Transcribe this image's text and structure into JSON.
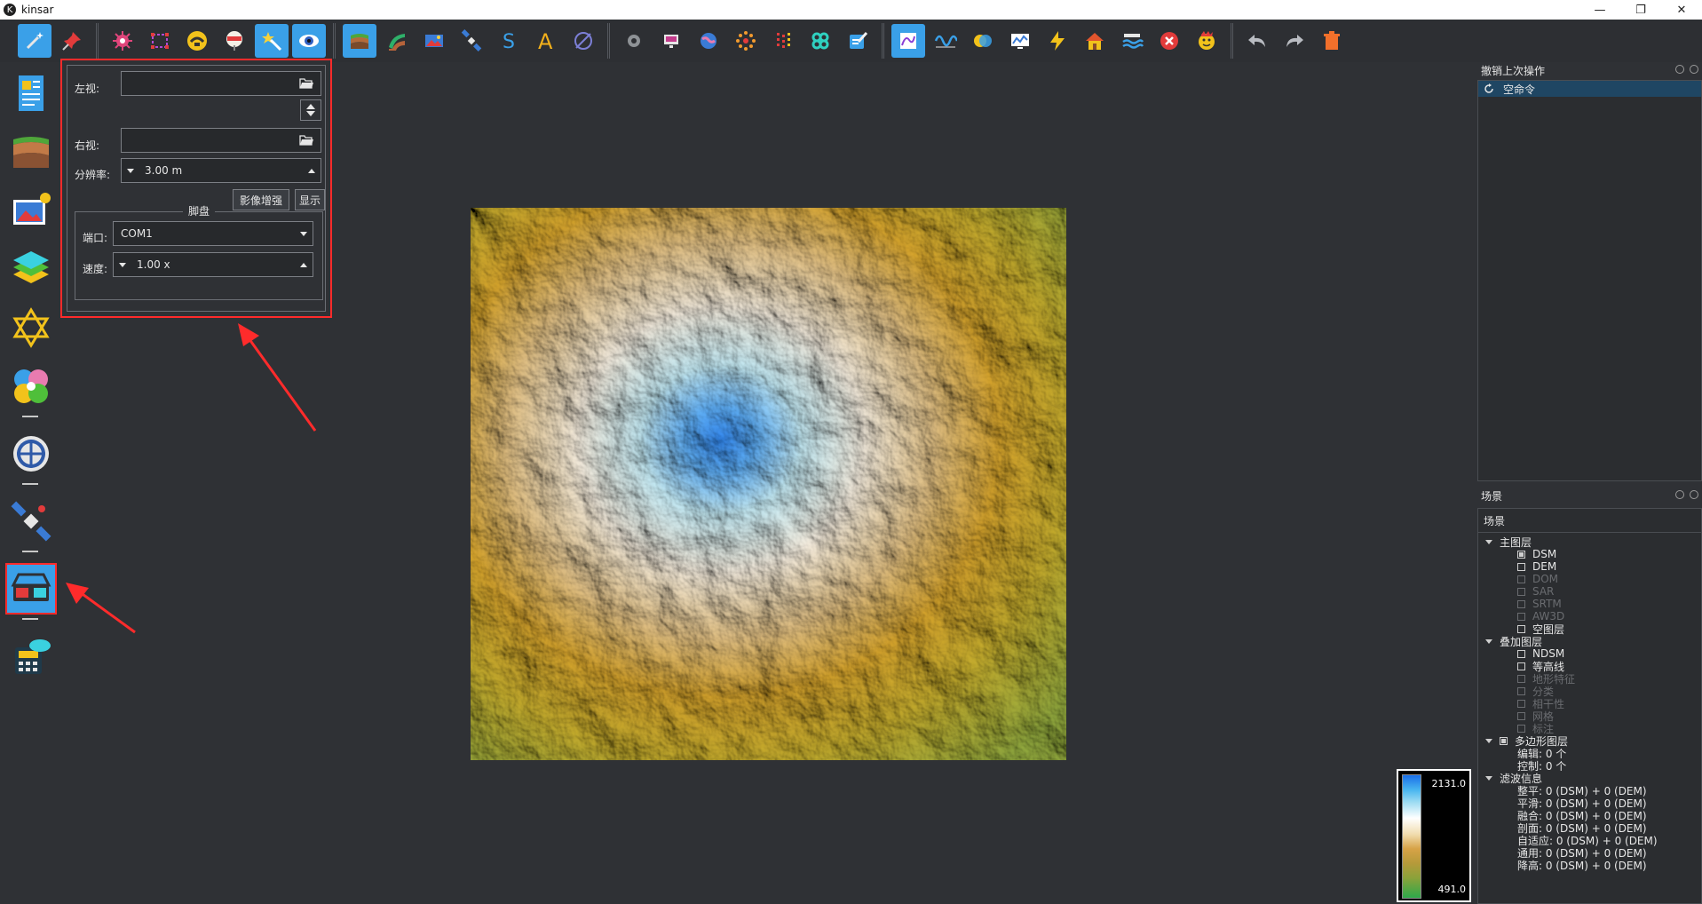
{
  "window": {
    "title": "kinsar",
    "logo": "K",
    "minimize": "—",
    "maximize": "❐",
    "close": "✕"
  },
  "toolbar": {
    "groups": [
      [
        "magic-wand-icon",
        "pin-icon"
      ],
      [
        "virus-icon",
        "vector-select-icon",
        "caution-sign-icon",
        "road-sign-icon",
        "star-wand-icon",
        "eye-icon"
      ],
      [
        "terrain-layers-icon",
        "layers-curve-icon",
        "image-edit-icon",
        "satellite-icon",
        "text-s-icon",
        "text-a-icon",
        "null-icon"
      ],
      [
        "cloud-gear-icon",
        "monitor-icon",
        "globe-icon",
        "sparkle-icon",
        "dots-grid-icon",
        "flower-icon",
        "pen-paper-icon"
      ],
      [
        "chart-frame-icon",
        "wave-icon",
        "overlap-circles-icon",
        "screen-graph-icon",
        "lightning-icon",
        "house-icon",
        "water-icon",
        "close-circle-icon",
        "face-icon"
      ],
      [
        "undo-icon",
        "redo-icon",
        "trash-icon"
      ]
    ]
  },
  "left_panel": {
    "left_view_label": "左视:",
    "left_view_value": "",
    "right_view_label": "右视:",
    "right_view_value": "",
    "resolution_label": "分辨率:",
    "resolution_value": "3.00 m",
    "enhance_button": "影像增强",
    "show_button": "显示",
    "pedal_group": "脚盘",
    "port_label": "端口:",
    "port_value": "COM1",
    "speed_label": "速度:",
    "speed_value": "1.00 x"
  },
  "colorbar": {
    "max": "2131.0",
    "min": "491.0"
  },
  "undo_panel": {
    "title": "撤销上次操作",
    "items": [
      "空命令"
    ]
  },
  "scene_panel": {
    "title": "场景",
    "header": "场景",
    "main_layer": "主图层",
    "main_items": [
      {
        "label": "DSM",
        "checked": true,
        "dim": false
      },
      {
        "label": "DEM",
        "checked": false,
        "dim": false
      },
      {
        "label": "DOM",
        "checked": false,
        "dim": true
      },
      {
        "label": "SAR",
        "checked": false,
        "dim": true
      },
      {
        "label": "SRTM",
        "checked": false,
        "dim": true
      },
      {
        "label": "AW3D",
        "checked": false,
        "dim": true
      },
      {
        "label": "空图层",
        "checked": false,
        "dim": false
      }
    ],
    "overlay_layer": "叠加图层",
    "overlay_items": [
      {
        "label": "NDSM",
        "checked": false,
        "dim": false
      },
      {
        "label": "等高线",
        "checked": false,
        "dim": false
      },
      {
        "label": "地形特征",
        "checked": false,
        "dim": true
      },
      {
        "label": "分类",
        "checked": false,
        "dim": true
      },
      {
        "label": "相干性",
        "checked": false,
        "dim": true
      },
      {
        "label": "网格",
        "checked": false,
        "dim": true
      },
      {
        "label": "标注",
        "checked": false,
        "dim": true
      }
    ],
    "polygon_layer": "多边形图层",
    "polygon_items": [
      "编辑: 0 个",
      "控制: 0 个"
    ],
    "filter_info": "滤波信息",
    "filter_items": [
      "整平: 0 (DSM) + 0 (DEM)",
      "平滑: 0 (DSM) + 0 (DEM)",
      "融合: 0 (DSM) + 0 (DEM)",
      "剖面: 0 (DSM) + 0 (DEM)",
      "自适应: 0 (DSM) + 0 (DEM)",
      "通用: 0 (DSM) + 0 (DEM)",
      "降高: 0 (DSM) + 0 (DEM)"
    ]
  }
}
